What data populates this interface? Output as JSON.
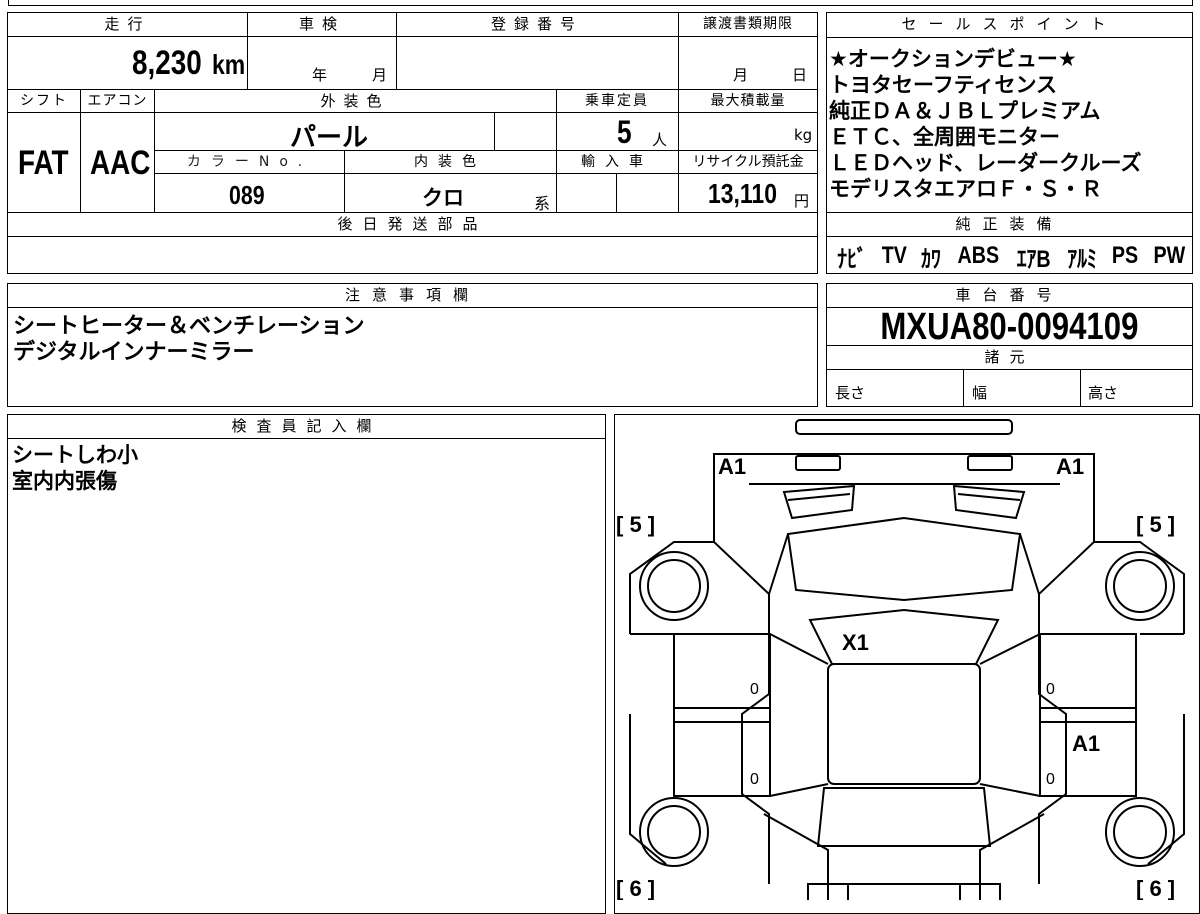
{
  "main_table": {
    "headers": {
      "mileage": "走行",
      "inspection": "車検",
      "registration_no": "登録番号",
      "transfer_deadline": "譲渡書類期限",
      "shift": "シフト",
      "aircon": "エアコン",
      "exterior_color": "外装色",
      "capacity": "乗車定員",
      "max_load": "最大積載量",
      "color_no": "カラーNo.",
      "interior_color": "内装色",
      "import_car": "輸入車",
      "recycle_fee": "リサイクル預託金",
      "later_parts": "後日発送部品"
    },
    "mileage_value": "8,230",
    "mileage_unit": "km",
    "inspection_year": "年",
    "inspection_month": "月",
    "deadline_month": "月",
    "deadline_day": "日",
    "shift_value": "FAT",
    "aircon_value": "AAC",
    "exterior_color_value": "パール",
    "capacity_value": "5",
    "capacity_unit": "人",
    "max_load_unit": "kg",
    "color_no_value": "089",
    "interior_color_value": "クロ",
    "interior_color_suffix": "系",
    "recycle_value": "13,110",
    "recycle_unit": "円"
  },
  "sales_points": {
    "header": "セールスポイント",
    "lines": [
      "★オークションデビュー★",
      "トヨタセーフティセンス",
      "純正ＤＡ＆ＪＢＬプレミアム",
      "ＥＴＣ、全周囲モニター",
      "ＬＥＤヘッド、レーダークルーズ",
      "モデリスタエアロＦ・Ｓ・Ｒ"
    ]
  },
  "genuine_equipment": {
    "header": "純正装備",
    "items": [
      "ﾅﾋﾞ",
      "TV",
      "ｶﾜ",
      "ABS",
      "ｴｱB",
      "ｱﾙﾐ",
      "PS",
      "PW"
    ]
  },
  "notes": {
    "header": "注意事項欄",
    "lines": [
      "シートヒーター＆ベンチレーション",
      "デジタルインナーミラー"
    ]
  },
  "chassis": {
    "header": "車台番号",
    "value": "MXUA80-0094109",
    "spec_header": "諸元",
    "length": "長さ",
    "width": "幅",
    "height": "高さ"
  },
  "inspector": {
    "header": "検査員記入欄",
    "lines": [
      "シートしわ小",
      "室内内張傷"
    ]
  },
  "diagram": {
    "marks": {
      "front_left": "A1",
      "front_right": "A1",
      "windshield": "X1",
      "right_rear_door": "A1",
      "left_front_door": "0",
      "left_rear_door": "0",
      "right_front_door": "0",
      "right_rear_door_base": "0"
    },
    "tire_labels": {
      "front_left": "[ 5 ]",
      "front_right": "[ 5 ]",
      "rear_left": "[ 6 ]",
      "rear_right": "[ 6 ]"
    }
  }
}
